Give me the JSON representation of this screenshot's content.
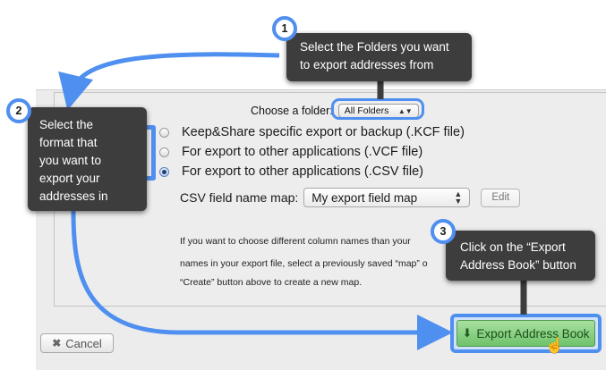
{
  "dialog": {
    "folder_label": "Choose a folder:",
    "folder_value": "All Folders",
    "format_options": [
      {
        "label": "Keep&Share specific export or backup (.KCF file)",
        "selected": false
      },
      {
        "label": "For export to other applications (.VCF file)",
        "selected": false
      },
      {
        "label": "For export to other applications (.CSV file)",
        "selected": true
      }
    ],
    "map_label": "CSV field name map:",
    "map_value": "My export field map",
    "edit_label": "Edit",
    "help_lines": [
      "If you want to choose different column names than your",
      "names in your export file, select a previously saved “map” o",
      "“Create” button above to create a new map."
    ],
    "cancel_label": "Cancel",
    "export_label": "Export Address Book"
  },
  "callouts": [
    {
      "number": "1",
      "lines": [
        "Select the Folders you want",
        "to export addresses from"
      ]
    },
    {
      "number": "2",
      "lines": [
        "Select the",
        "format that",
        "you want to",
        "export your",
        "addresses in"
      ]
    },
    {
      "number": "3",
      "lines": [
        "Click on the “Export",
        "Address Book” button"
      ]
    }
  ],
  "colors": {
    "highlight_blue": "#4f8ff0",
    "callout_bg": "#3d3d3d",
    "export_green": "#6fc26a"
  },
  "icons": {
    "cancel": "close-icon",
    "export": "download-icon",
    "cursor": "hand-pointer-icon"
  }
}
